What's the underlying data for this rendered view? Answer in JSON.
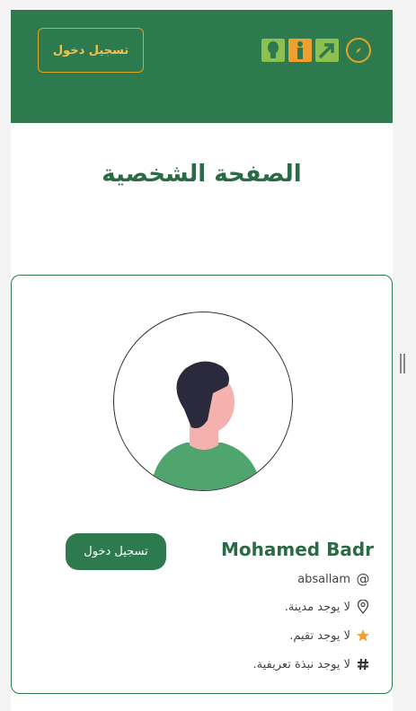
{
  "header": {
    "login_label": "تسجيل دخول",
    "logo_icons": [
      "compass-icon",
      "arrow-up-right-icon",
      "person-icon",
      "bulb-icon"
    ],
    "colors": {
      "bg": "#2e7a4f",
      "accent": "#e0a526",
      "logo_green": "#8cc152",
      "logo_orange": "#f0a030"
    }
  },
  "page": {
    "title": "الصفحة الشخصية"
  },
  "profile": {
    "name": "Mohamed Badr",
    "username": "absallam",
    "username_prefix": "@",
    "city": "لا يوجد مدينة.",
    "rating": "لا يوجد تقيم.",
    "bio": "لا يوجد نبذة تعريفية.",
    "login_label": "تسجيل دخول",
    "icons": [
      "at-icon",
      "location-pin-icon",
      "star-icon",
      "hash-icon"
    ]
  }
}
